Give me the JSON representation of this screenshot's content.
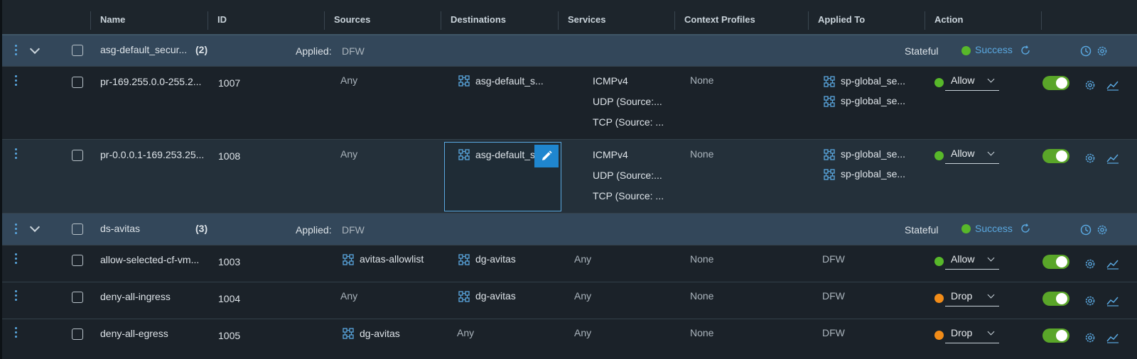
{
  "columns": [
    "Name",
    "ID",
    "Sources",
    "Destinations",
    "Services",
    "Context Profiles",
    "Applied To",
    "Action"
  ],
  "colors": {
    "accent": "#5aa8e0",
    "allow": "#58b82a",
    "drop": "#f28c18",
    "toggle_on": "#5aa629"
  },
  "sections": [
    {
      "name": "asg-default_secur...",
      "count": "(2)",
      "applied_label": "Applied:",
      "applied_value": "DFW",
      "mode": "Stateful",
      "status": "Success",
      "rules": [
        {
          "name": "pr-169.255.0.0-255.2...",
          "id": "1007",
          "sources": "Any",
          "destinations": "asg-default_s...",
          "services": [
            "ICMPv4",
            "UDP (Source:...",
            "TCP (Source: ..."
          ],
          "context": "None",
          "applied_to": [
            "sp-global_se...",
            "sp-global_se..."
          ],
          "action": "Allow",
          "enabled": true
        },
        {
          "name": "pr-0.0.0.1-169.253.25...",
          "id": "1008",
          "sources": "Any",
          "destinations": "asg-default_s",
          "services": [
            "ICMPv4",
            "UDP (Source:...",
            "TCP (Source: ..."
          ],
          "context": "None",
          "applied_to": [
            "sp-global_se...",
            "sp-global_se..."
          ],
          "action": "Allow",
          "enabled": true
        }
      ]
    },
    {
      "name": "ds-avitas",
      "count": "(3)",
      "applied_label": "Applied:",
      "applied_value": "DFW",
      "mode": "Stateful",
      "status": "Success",
      "rules": [
        {
          "name": "allow-selected-cf-vm...",
          "id": "1003",
          "sources": "avitas-allowlist",
          "destinations": "dg-avitas",
          "services": "Any",
          "context": "None",
          "applied_to": "DFW",
          "action": "Allow",
          "enabled": true
        },
        {
          "name": "deny-all-ingress",
          "id": "1004",
          "sources": "Any",
          "destinations": "dg-avitas",
          "services": "Any",
          "context": "None",
          "applied_to": "DFW",
          "action": "Drop",
          "enabled": true
        },
        {
          "name": "deny-all-egress",
          "id": "1005",
          "sources": "dg-avitas",
          "destinations": "Any",
          "services": "Any",
          "context": "None",
          "applied_to": "DFW",
          "action": "Drop",
          "enabled": true
        }
      ]
    }
  ]
}
